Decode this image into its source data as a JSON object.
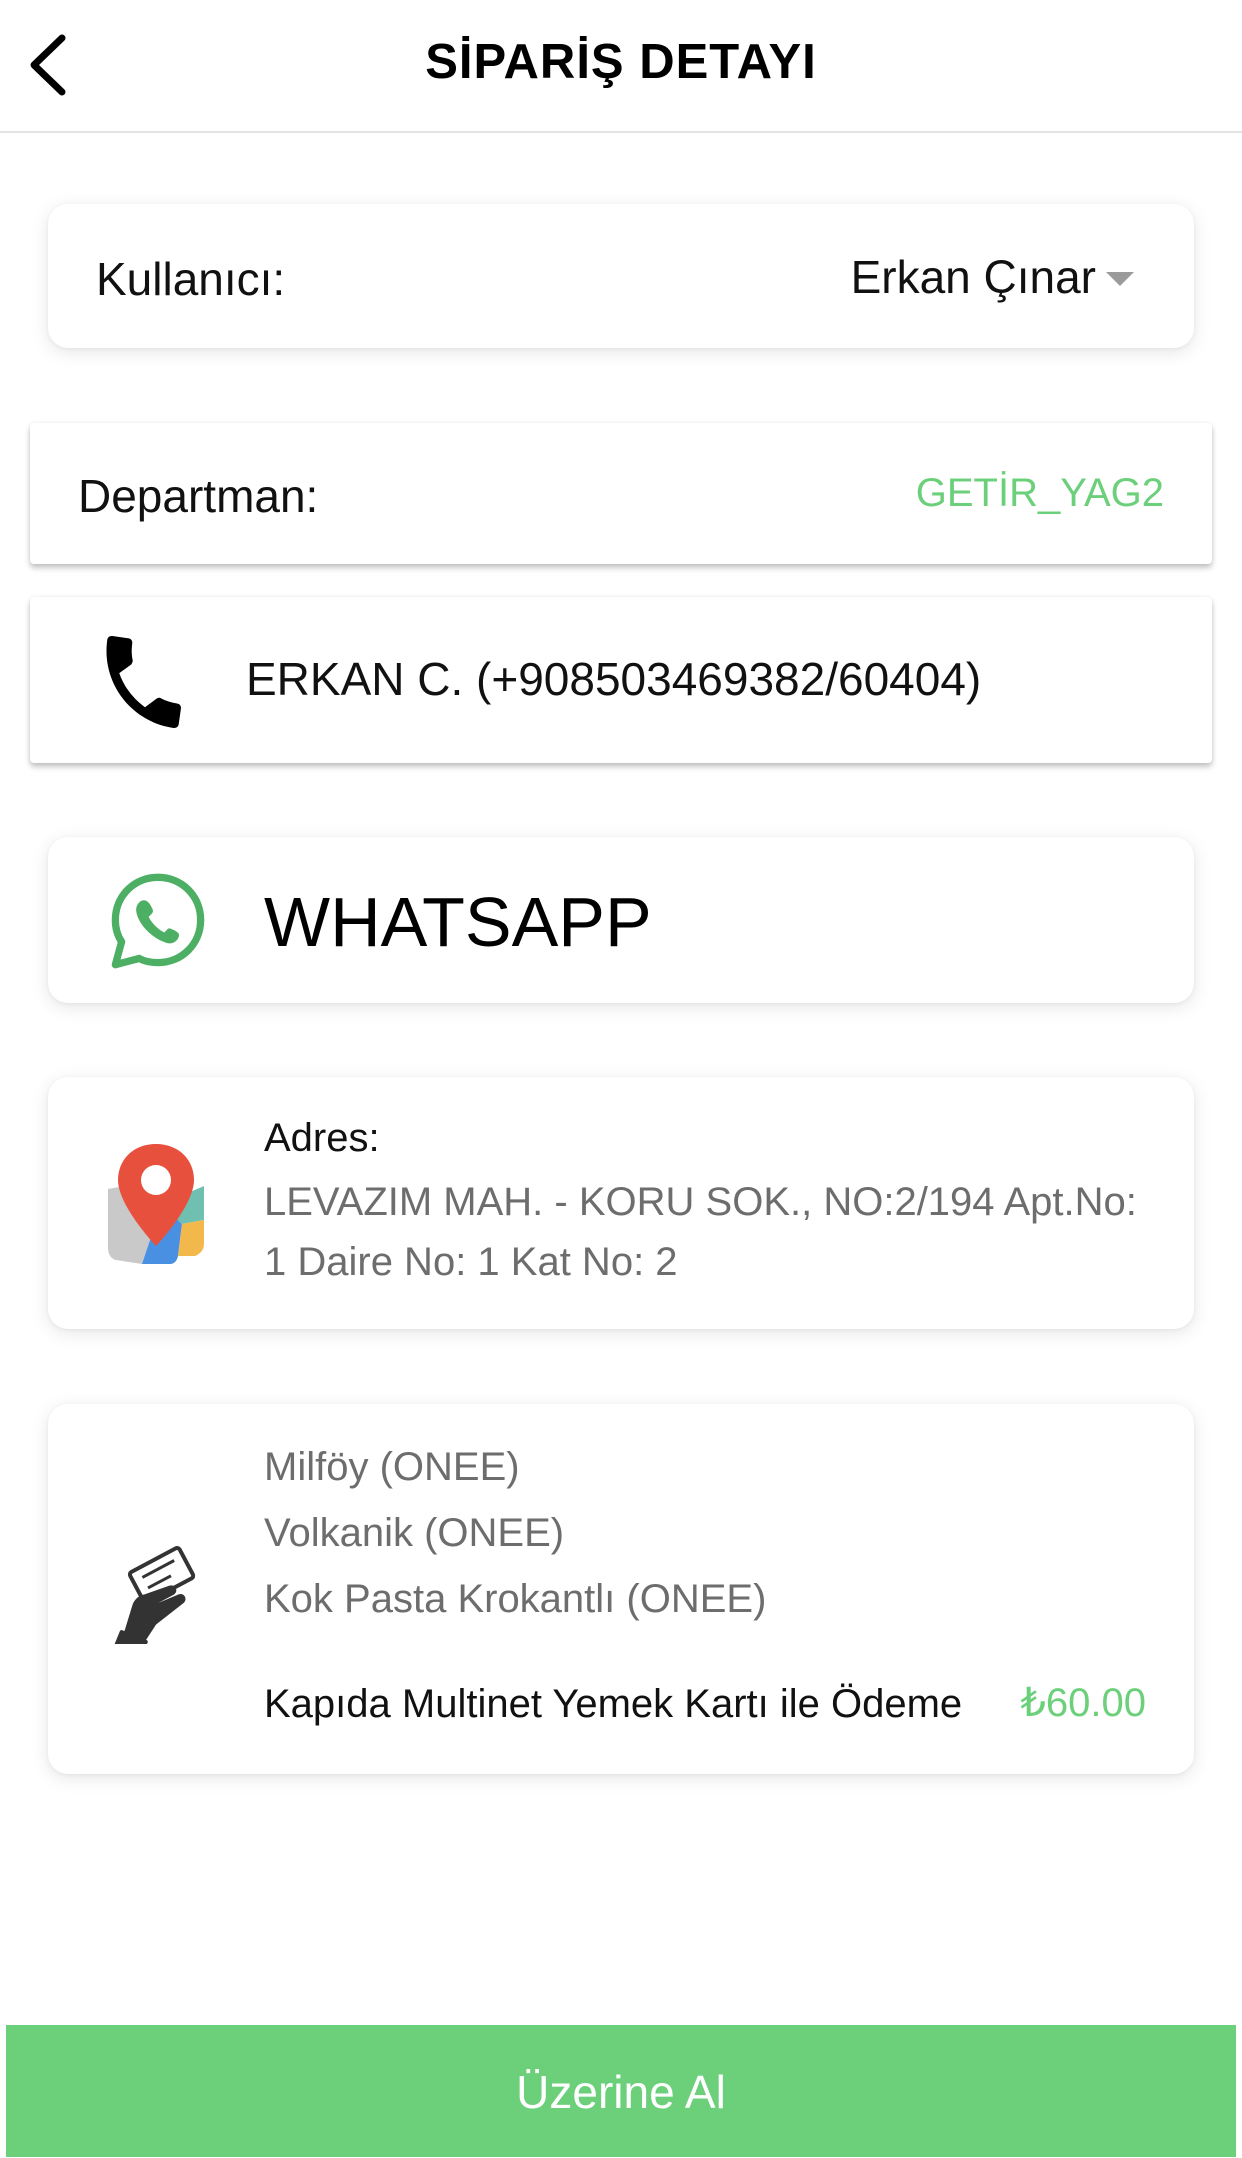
{
  "header": {
    "title": "SİPARİŞ DETAYI",
    "back_icon": "chevron-left-icon"
  },
  "user": {
    "label": "Kullanıcı:",
    "value": "Erkan Çınar"
  },
  "department": {
    "label": "Departman:",
    "value": "GETİR_YAG2"
  },
  "contact": {
    "phone_icon": "phone-icon",
    "text": "ERKAN C. (+908503469382/60404)"
  },
  "whatsapp": {
    "icon": "whatsapp-icon",
    "label": "WHATSAPP"
  },
  "address": {
    "icon": "map-pin-icon",
    "label": "Adres:",
    "line1": "LEVAZIM MAH. - KORU SOK., NO:2/194 Apt.No:",
    "line2": "1 Daire No: 1 Kat No: 2"
  },
  "order": {
    "icon": "payment-hand-icon",
    "items": [
      "Milföy (ONEE)",
      "Volkanik (ONEE)",
      "Kok Pasta Krokantlı (ONEE)"
    ],
    "payment_method": "Kapıda Multinet Yemek Kartı ile Ödeme",
    "total": "₺60.00"
  },
  "actions": {
    "take_button": "Üzerine Al"
  },
  "colors": {
    "accent_green": "#6cd07b",
    "whatsapp_green": "#4caf64",
    "muted_text": "#6d6d6d"
  }
}
